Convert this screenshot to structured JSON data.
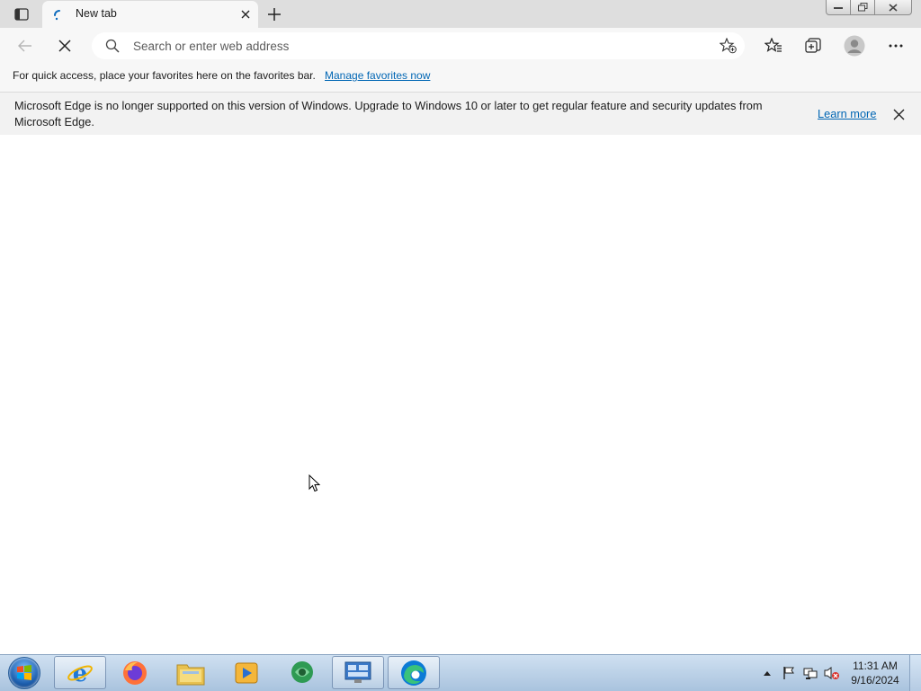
{
  "window": {
    "tab_title": "New tab"
  },
  "toolbar": {
    "address_placeholder": "Search or enter web address"
  },
  "favorites_bar": {
    "text": "For quick access, place your favorites here on the favorites bar.",
    "link": "Manage favorites now"
  },
  "infobar": {
    "message": "Microsoft Edge is no longer supported on this version of Windows. Upgrade to Windows 10 or later to get regular feature and security updates from Microsoft Edge.",
    "learn_more": "Learn more"
  },
  "taskbar": {
    "apps": [
      "internet-explorer",
      "firefox",
      "file-explorer",
      "media-player",
      "network-app",
      "remote-desktop",
      "microsoft-edge"
    ],
    "clock_time": "11:31 AM",
    "clock_date": "9/16/2024"
  },
  "colors": {
    "link": "#0066b4",
    "tabstrip": "#dedede",
    "toolbar": "#f7f7f7",
    "taskbar": "#b9d1ea"
  }
}
